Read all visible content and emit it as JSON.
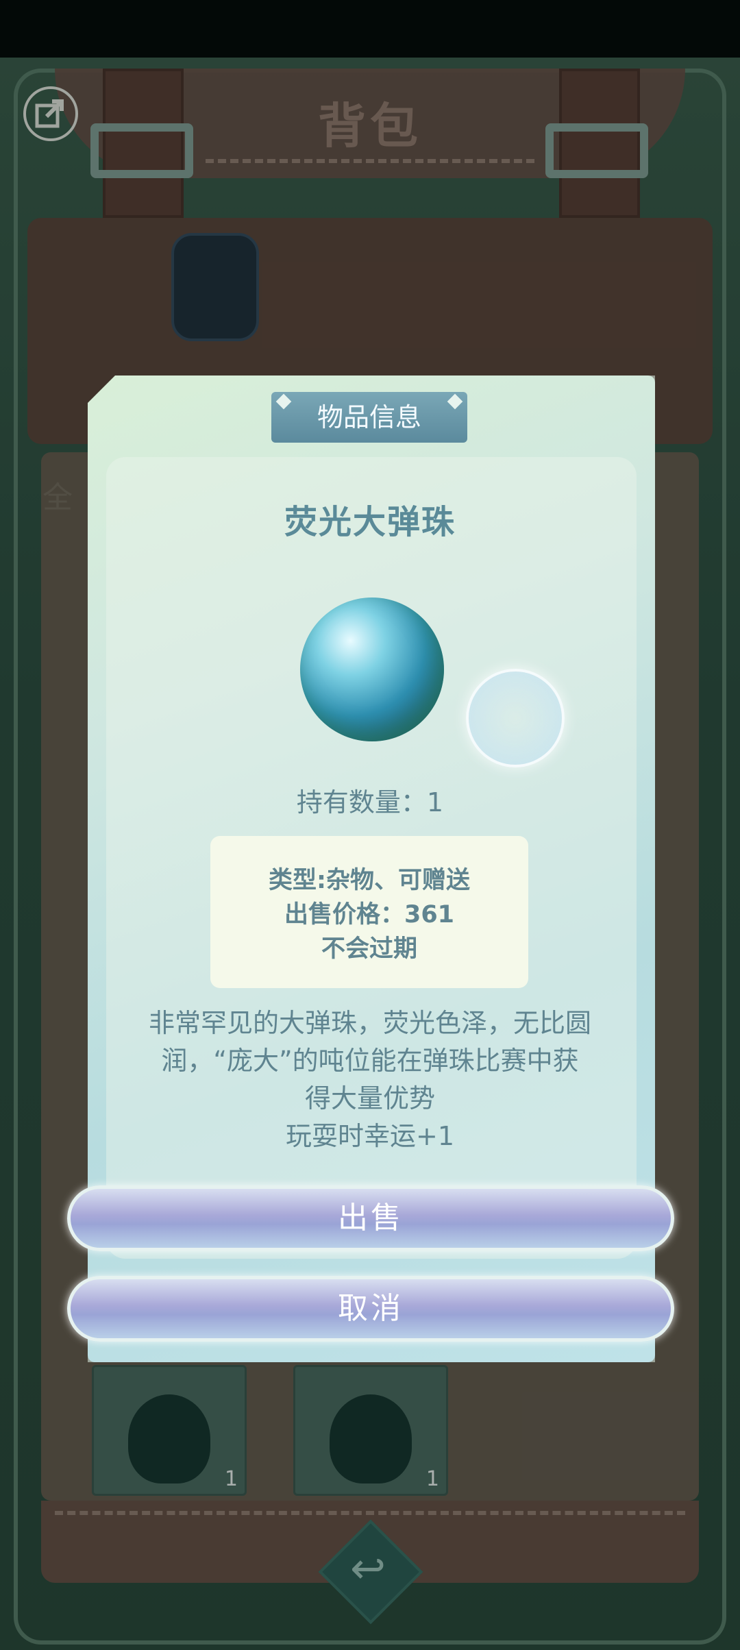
{
  "header": {
    "title": "背包"
  },
  "tabs": {
    "first_tab_partial": "全"
  },
  "inventory": {
    "slots": [
      {
        "count": "1"
      },
      {
        "count": "1"
      }
    ]
  },
  "popup": {
    "tab_title": "物品信息",
    "item_name": "荧光大弹珠",
    "quantity_text": "持有数量：1",
    "type_text": "类型:杂物、可赠送",
    "price_text": "出售价格：361",
    "expiry_text": "不会过期",
    "description_lines": [
      "非常罕见的大弹珠，荧光色泽，无比圆",
      "润，“庞大”的吨位能在弹珠比赛中获",
      "得大量优势",
      "玩耍时幸运+1"
    ],
    "sell_label": "出售",
    "cancel_label": "取消"
  },
  "icons": {
    "exit": "exit-icon",
    "back": "back-arrow-icon",
    "item": "marble-icon"
  }
}
